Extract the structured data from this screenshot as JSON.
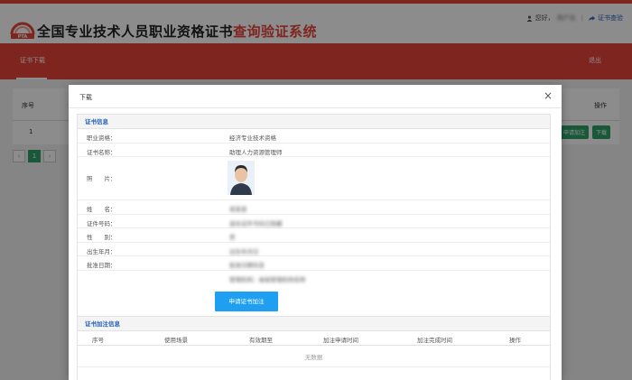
{
  "header": {
    "title_main": "全国专业技术人员职业资格证书",
    "title_accent": "查询验证系统",
    "greeting": "您好，",
    "username": "用户名",
    "verify_link": "证书查验",
    "icon_user": "user-icon",
    "icon_share": "share-icon"
  },
  "nav": {
    "tab_download": "证书下载",
    "logout": "退出"
  },
  "background": {
    "col_index": "序号",
    "col_action": "操作",
    "row_index": "1",
    "btn_apply": "申请加注",
    "btn_download": "下载",
    "pager_prev": "‹",
    "pager_page": "1",
    "pager_next": "›"
  },
  "modal": {
    "title": "下载",
    "close": "×",
    "cert_section_title": "证书信息",
    "fields": [
      {
        "label": "职业资格：",
        "value": "经济专业技术资格",
        "blurred": false
      },
      {
        "label": "证书名称：",
        "value": "助理人力资源管理师",
        "blurred": false
      },
      {
        "label": "照　　片：",
        "value": "",
        "blurred": false
      },
      {
        "label": "姓　　名：",
        "value": "某某某",
        "blurred": true
      },
      {
        "label": "证件号码：",
        "value": "身份证件号码已隐藏",
        "blurred": true
      },
      {
        "label": "性　　别：",
        "value": "男",
        "blurred": true
      },
      {
        "label": "出生年月：",
        "value": "出生年月日",
        "blurred": true
      },
      {
        "label": "批准日期：",
        "value": "批准日期信息",
        "blurred": true
      },
      {
        "label": "",
        "value": "管理机构：省级管理机构名称",
        "blurred": true
      }
    ],
    "apply_button": "申请证书加注",
    "note_section_title": "证书加注信息",
    "note_columns": [
      "序号",
      "使用场景",
      "有效期至",
      "加注申请时间",
      "加注完成时间",
      "操作"
    ],
    "no_data": "无数据"
  },
  "colors": {
    "brand_red": "#e8443a",
    "link_blue": "#2a63b8",
    "button_blue": "#1e9ff2",
    "button_green": "#2fa36b"
  }
}
